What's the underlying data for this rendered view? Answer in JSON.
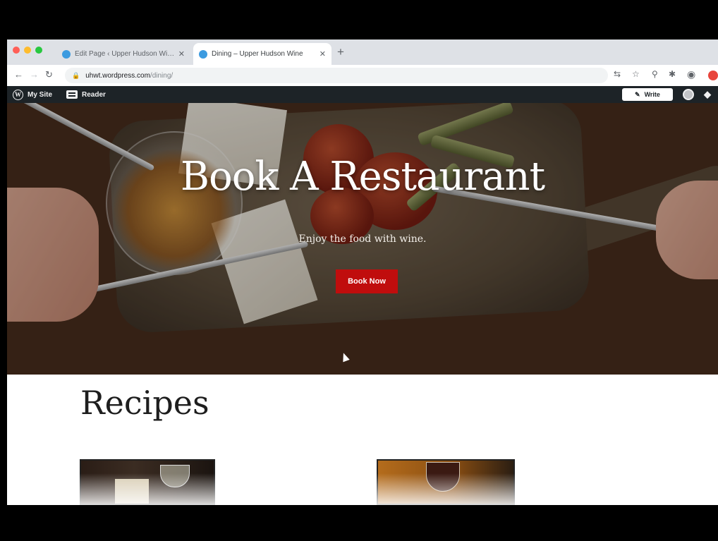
{
  "browser": {
    "tabs": [
      {
        "title": "Edit Page ‹ Upper Hudson Wi…",
        "active": false
      },
      {
        "title": "Dining – Upper Hudson Wine",
        "active": true
      }
    ],
    "new_tab_icon": "plus-icon",
    "url_host": "uhwt.wordpress.com",
    "url_path": "/dining/",
    "colors": {
      "tab_strip": "#dee1e6",
      "close_red": "#ff5f57",
      "minimize_yellow": "#febc2e",
      "zoom_green": "#28c840"
    }
  },
  "adminbar": {
    "my_site": "My Site",
    "reader": "Reader",
    "write": "Write"
  },
  "hero": {
    "title": "Book A Restaurant",
    "subtitle": "Enjoy the food with wine.",
    "button": "Book Now",
    "button_color": "#c00d0d"
  },
  "content": {
    "section_title": "Recipes"
  }
}
